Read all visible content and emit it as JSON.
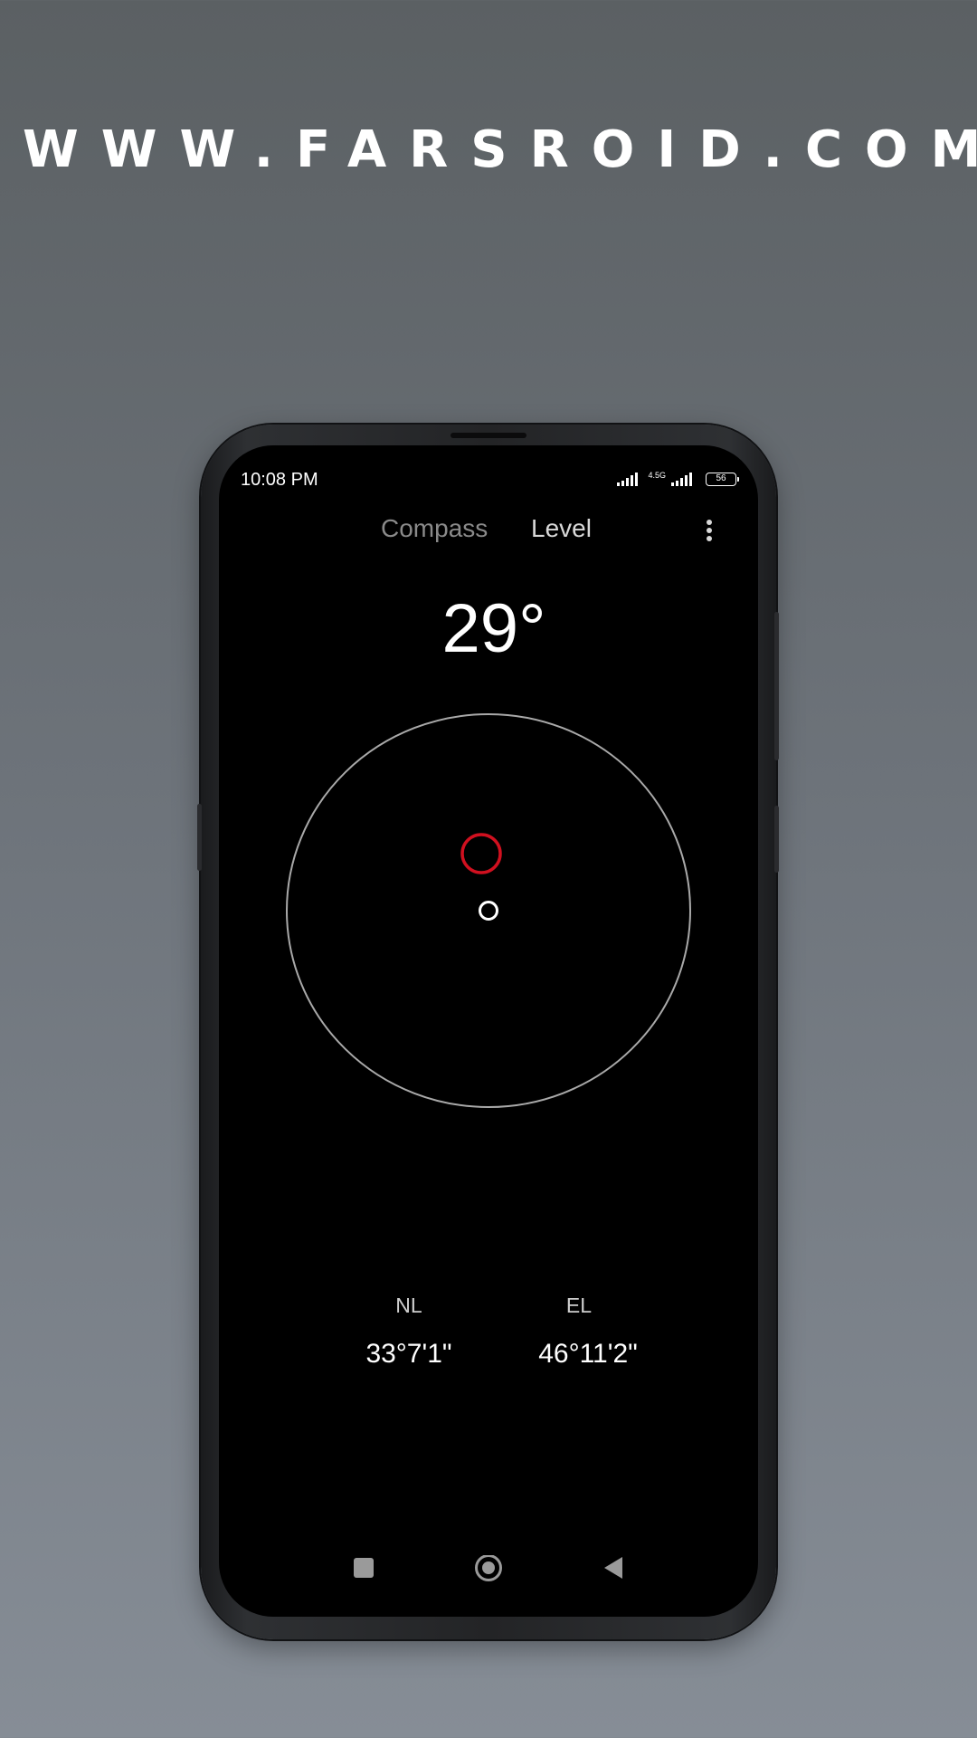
{
  "watermark": "WWW.FARSROID.COM",
  "status_bar": {
    "time": "10:08 PM",
    "network_label": "4.5G",
    "battery_level": "56",
    "icons": [
      "signal-icon",
      "signal-icon",
      "battery-icon"
    ]
  },
  "tabs": [
    {
      "label": "Compass",
      "active": false
    },
    {
      "label": "Level",
      "active": true
    }
  ],
  "menu_icon": "more-vertical-icon",
  "level": {
    "angle": "29°",
    "bubble_color": "#d0101f",
    "ring_color": "#a9a9a9"
  },
  "coordinates": {
    "latitude_label": "NL",
    "latitude_value": "33°7'1\"",
    "longitude_label": "EL",
    "longitude_value": "46°11'2\""
  },
  "nav_bar": {
    "icons": [
      "recents-square-icon",
      "home-circle-icon",
      "back-triangle-icon"
    ]
  }
}
